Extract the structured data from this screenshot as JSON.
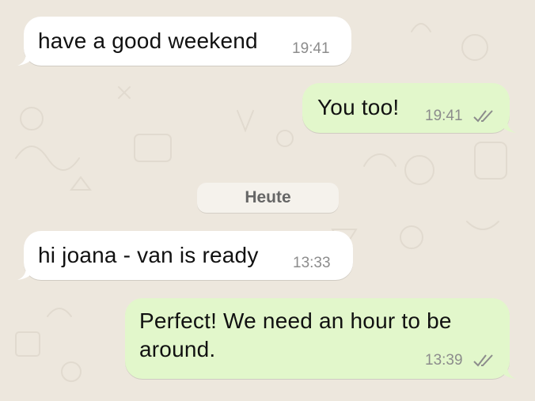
{
  "date_separator": "Heute",
  "messages": [
    {
      "direction": "incoming",
      "text": "have a good weekend",
      "time": "19:41"
    },
    {
      "direction": "outgoing",
      "text": "You too!",
      "time": "19:41",
      "status_icon": "double-check-icon"
    },
    {
      "direction": "incoming",
      "text": "hi joana - van is ready",
      "time": "13:33"
    },
    {
      "direction": "outgoing",
      "text": "Perfect! We need an hour to be around.",
      "time": "13:39",
      "status_icon": "double-check-icon"
    }
  ],
  "colors": {
    "background": "#EDE7DD",
    "incoming_bubble": "#FFFFFF",
    "outgoing_bubble": "#E2F7CB",
    "timestamp": "#8C8C8C",
    "date_chip": "#F5F2EC"
  }
}
